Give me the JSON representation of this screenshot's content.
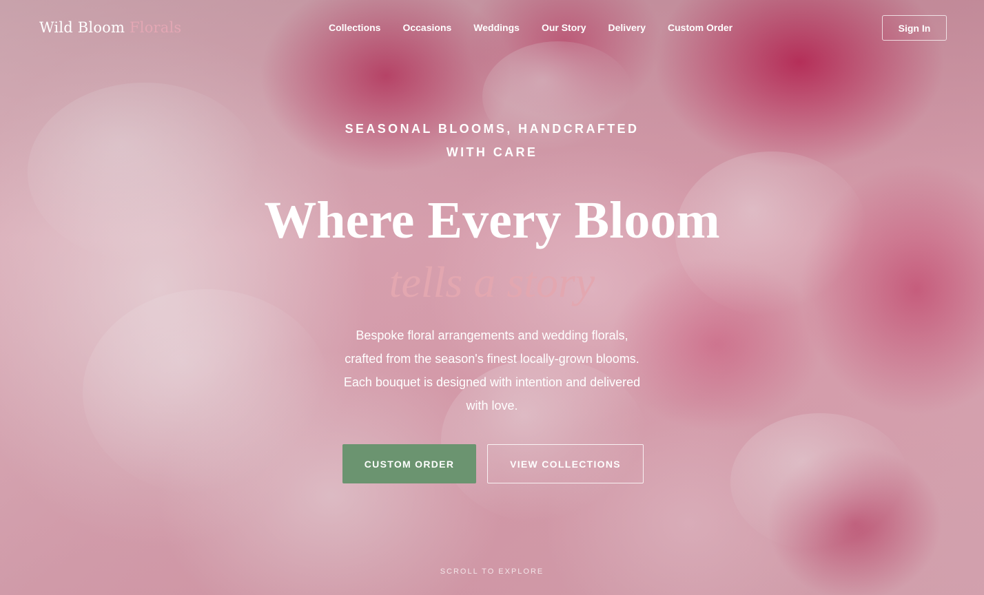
{
  "brand": {
    "name_primary": "Wild Bloom",
    "name_accent": "Florals"
  },
  "nav": {
    "items": [
      {
        "label": "Collections"
      },
      {
        "label": "Occasions"
      },
      {
        "label": "Weddings"
      },
      {
        "label": "Our Story"
      },
      {
        "label": "Delivery"
      },
      {
        "label": "Custom Order"
      }
    ],
    "signin_label": "Sign In"
  },
  "hero": {
    "eyebrow_line1": "SEASONAL BLOOMS, HANDCRAFTED",
    "eyebrow_line2": "WITH CARE",
    "headline": "Where Every Bloom",
    "subhead": "tells a story",
    "description_lines": [
      "Bespoke floral arrangements and wedding florals,",
      "crafted from the season's finest locally-grown blooms.",
      "Each bouquet is designed with intention and delivered",
      "with love."
    ],
    "primary_cta": "CUSTOM ORDER",
    "secondary_cta": "VIEW COLLECTIONS",
    "scroll_hint": "SCROLL TO EXPLORE"
  },
  "colors": {
    "accent_pink": "#e3a7b0",
    "cta_green": "#6b9470",
    "text_white": "#ffffff"
  }
}
